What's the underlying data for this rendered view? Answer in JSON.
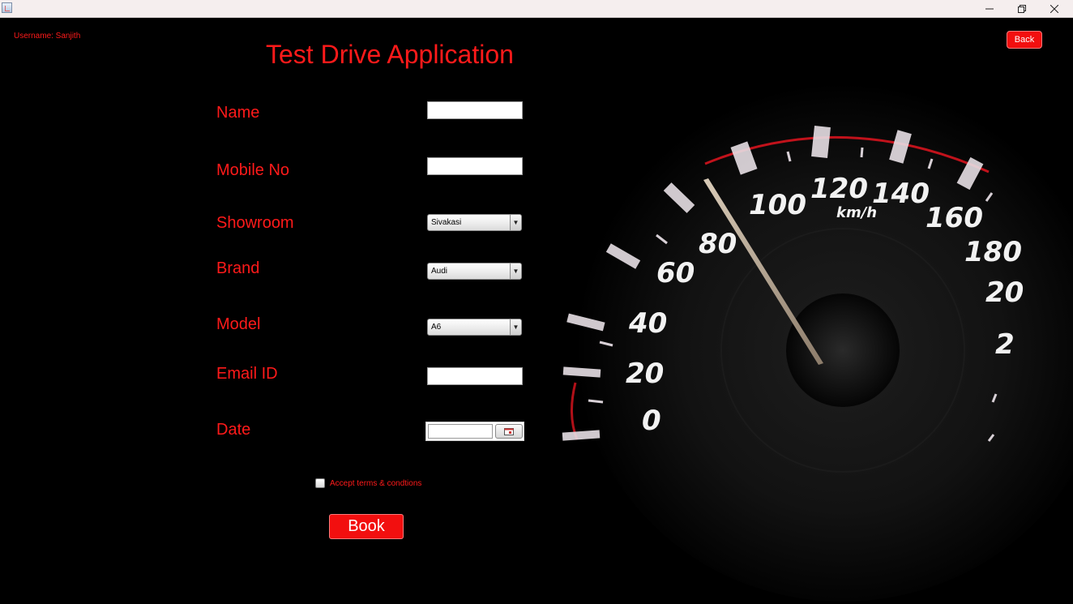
{
  "window": {
    "minimize_icon": "minimize-icon",
    "maximize_icon": "restore-icon",
    "close_icon": "close-icon"
  },
  "header": {
    "username": "Username: Sanjith",
    "title": "Test Drive Application",
    "back_label": "Back"
  },
  "form": {
    "name_label": "Name",
    "name_value": "",
    "mobile_label": "Mobile No",
    "mobile_value": "",
    "showroom_label": "Showroom",
    "showroom_value": "Sivakasi",
    "brand_label": "Brand",
    "brand_value": "Audi",
    "model_label": "Model",
    "model_value": "A6",
    "email_label": "Email ID",
    "email_value": "",
    "date_label": "Date",
    "date_value": "",
    "terms_label": "Accept terms & condtions",
    "terms_checked": false,
    "book_label": "Book"
  },
  "speedometer": {
    "ticks": [
      "0",
      "20",
      "40",
      "60",
      "80",
      "100",
      "120",
      "140",
      "160",
      "180",
      "20",
      "2"
    ],
    "unit": "km/h"
  },
  "colors": {
    "accent": "#ff1a1a",
    "button_bg": "#f20f0f",
    "background": "#000000"
  }
}
